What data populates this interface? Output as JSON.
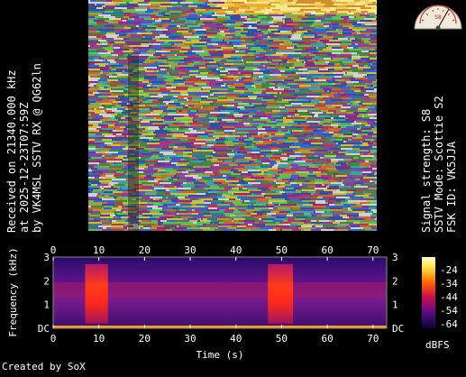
{
  "caption_left": {
    "line1": "Received on  21340.000 kHz",
    "line2": "at 2025-12-23T07:59Z",
    "line3": "by VK4MSL SSTV RX @ QG62ln"
  },
  "caption_right": {
    "line1": "Signal strength: S8",
    "line2": "SSTV Mode: Scottie S2",
    "line3": "FSK ID: VK5JJA"
  },
  "smeter": {
    "reading": "S8",
    "scale_text": "1 3 5 7 9 +20"
  },
  "spectrogram": {
    "title_x": "Time (s)",
    "title_y": "Frequency (kHz)",
    "x_ticks": [
      "0",
      "10",
      "20",
      "30",
      "40",
      "50",
      "60",
      "70"
    ],
    "y_ticks": [
      "DC",
      "1",
      "2",
      "3"
    ],
    "colorbar_ticks": [
      "-24",
      "-34",
      "-44",
      "-54",
      "-64"
    ],
    "colorbar_unit": "dBFS",
    "colors": {
      "background": "#1a0a55",
      "hot": "#ff2a1a",
      "tone": "#ff9e1a"
    }
  },
  "credit": "Created by SoX"
}
